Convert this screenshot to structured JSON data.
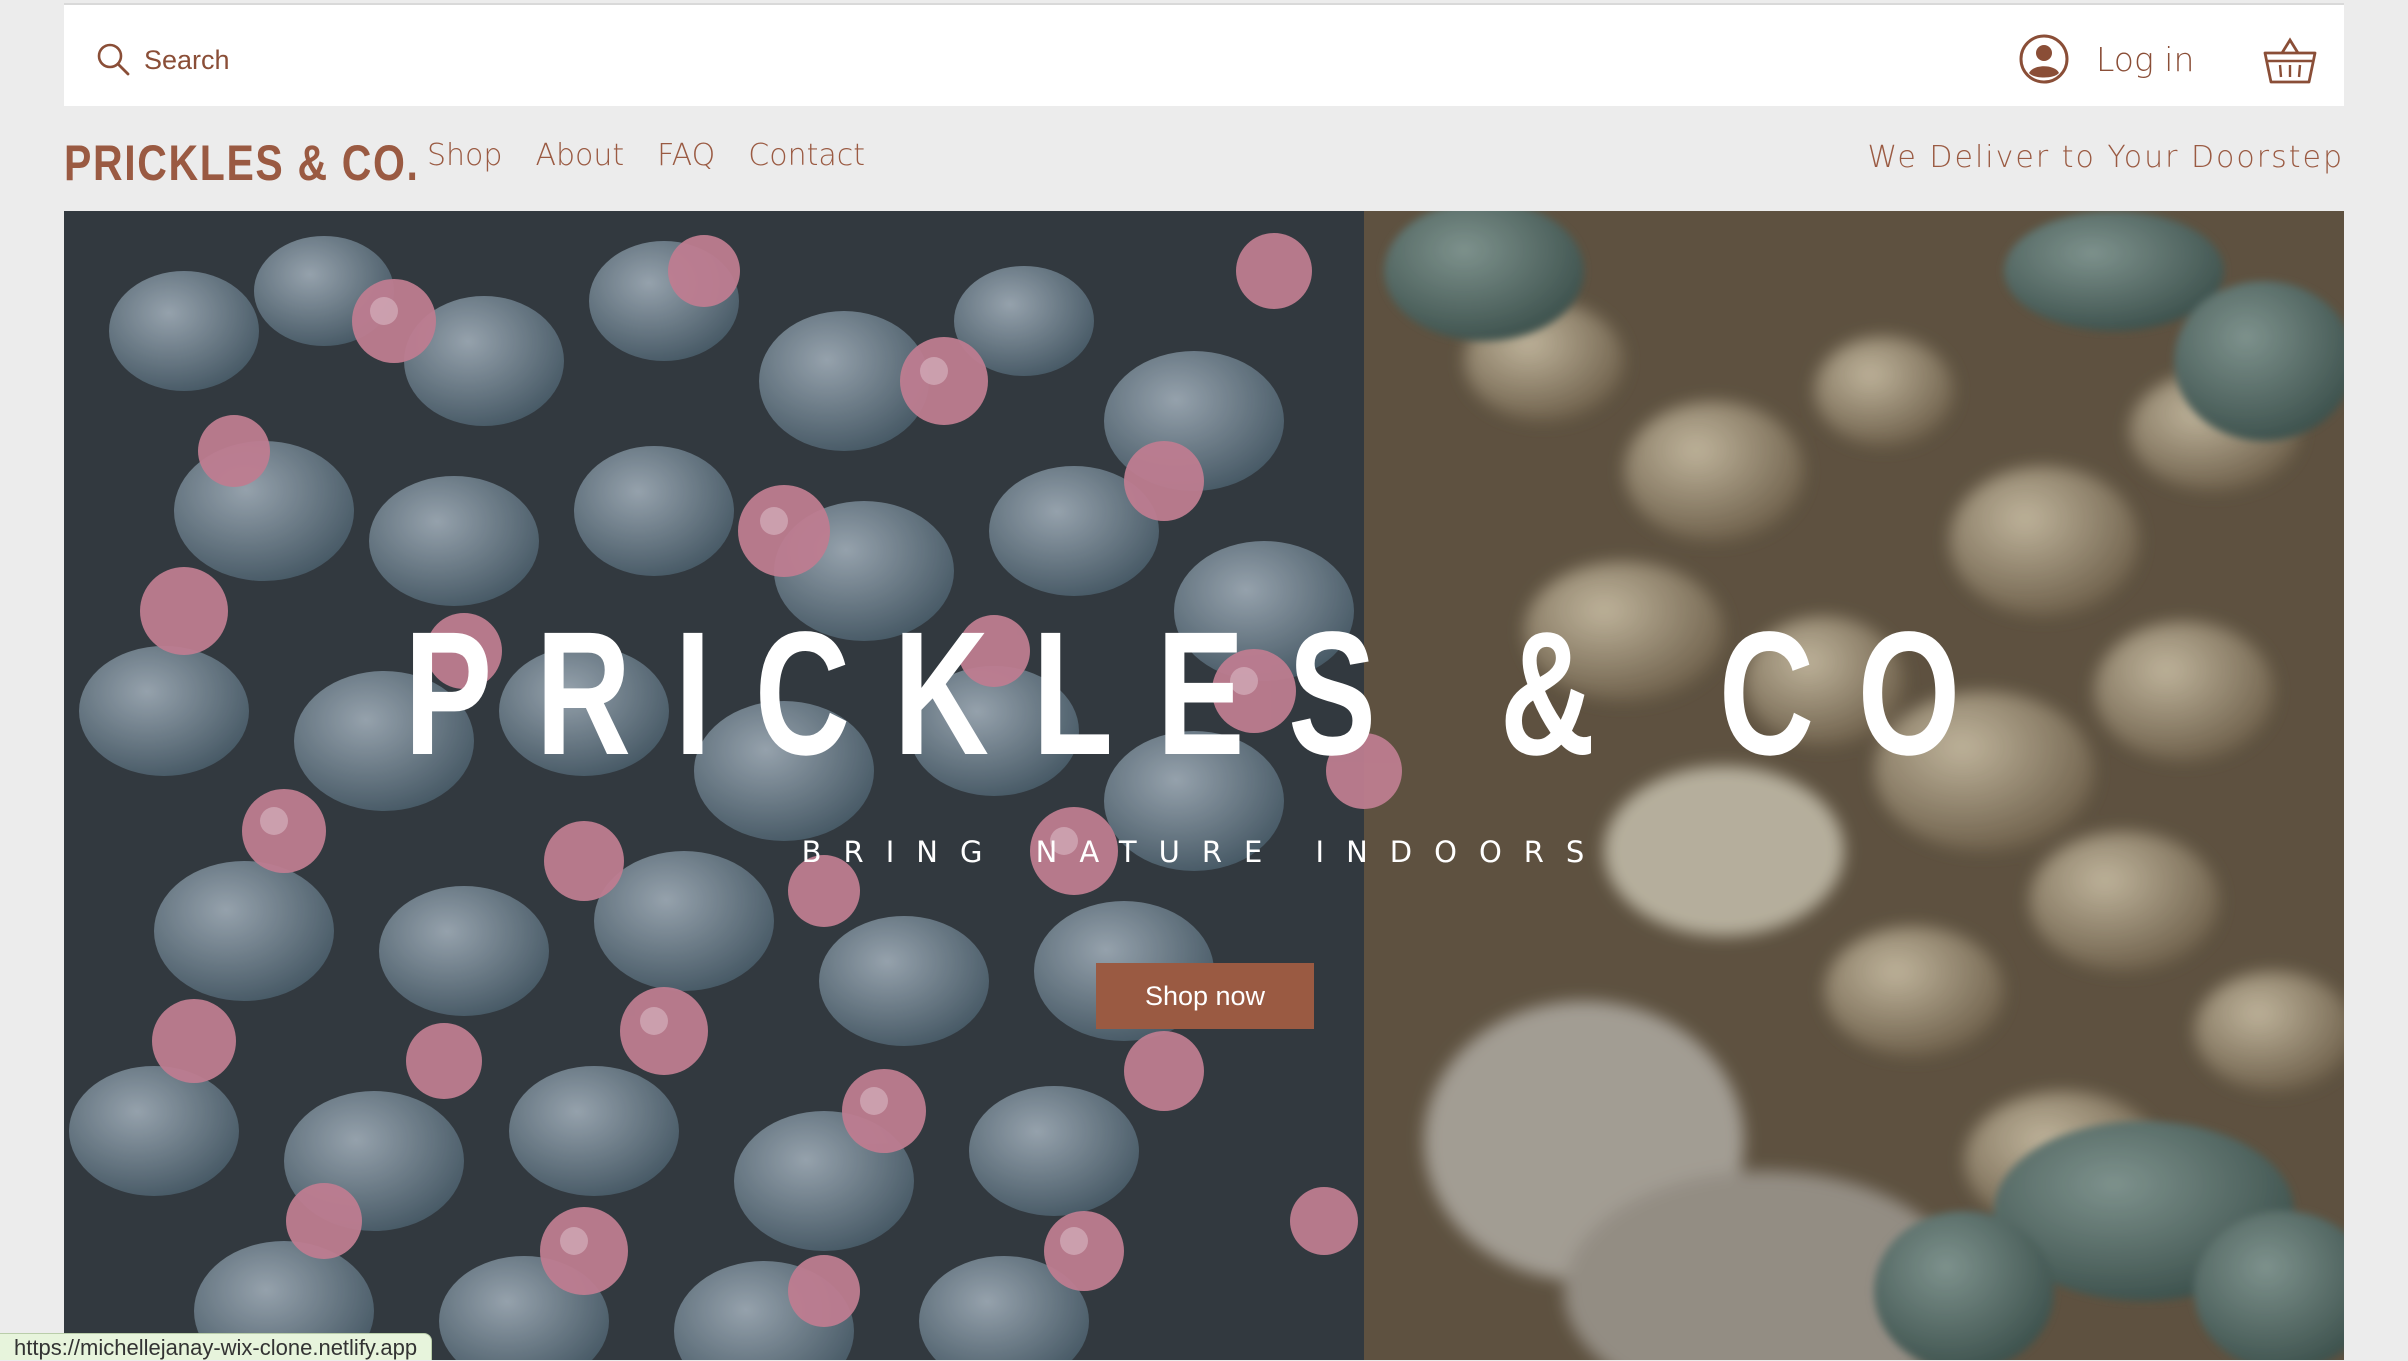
{
  "topbar": {
    "search_label": "Search",
    "login_label": "Log in",
    "icons": [
      "search-icon",
      "user-icon",
      "cart-icon"
    ]
  },
  "nav": {
    "brand": "PRICKLES & CO.",
    "items": [
      {
        "label": "Shop"
      },
      {
        "label": "About"
      },
      {
        "label": "FAQ"
      },
      {
        "label": "Contact"
      }
    ],
    "tagline": "We Deliver to Your Doorstep"
  },
  "hero": {
    "title": "PRICKLES & CO",
    "subtitle": "BRING NATURE INDOORS",
    "cta_label": "Shop now"
  },
  "statusbar": {
    "url": "https://michellejanay-wix-clone.netlify.app"
  },
  "colors": {
    "accent": "#9a5a42",
    "background": "#ececec",
    "header": "#ffffff"
  }
}
